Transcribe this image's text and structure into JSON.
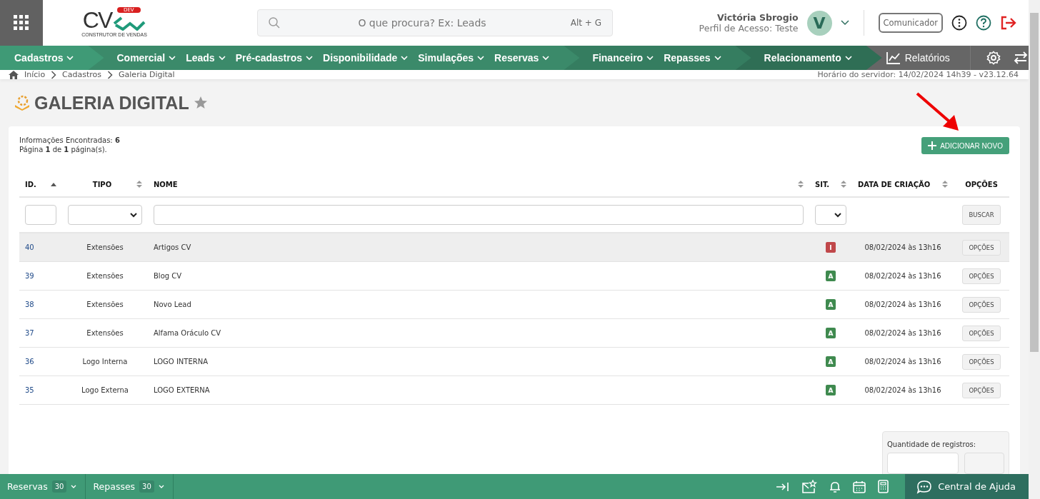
{
  "header": {
    "logo": {
      "mark": "CV",
      "badge": "DEV",
      "tagline": "CONSTRUTOR DE VENDAS"
    },
    "search": {
      "placeholder": "O que procura? Ex: Leads",
      "shortcut": "Alt + G"
    },
    "user": {
      "name": "Victória Sbrogio",
      "profile": "Perfil de Acesso: Teste",
      "initial": "V"
    },
    "communicator": "Comunicador"
  },
  "nav": {
    "groups": [
      {
        "items": [
          "Cadastros"
        ]
      },
      {
        "items": [
          "Comercial",
          "Leads",
          "Pré-cadastros",
          "Disponibilidade",
          "Simulações",
          "Reservas"
        ]
      },
      {
        "items": [
          "Financeiro",
          "Repasses"
        ]
      },
      {
        "items": [
          "Relacionamento"
        ]
      }
    ],
    "reports": "Relatórios"
  },
  "breadcrumb": [
    "Início",
    "Cadastros",
    "Galeria Digital"
  ],
  "server_time": "Horário do servidor: 14/02/2024 14h39 - v23.12.64",
  "page": {
    "title": "GALERIA DIGITAL",
    "favorite": false
  },
  "summary": {
    "found_label": "Informações Encontradas:",
    "found": "6",
    "page_text": "Página **1** de **1** página(s)."
  },
  "add_button": "ADICIONAR NOVO",
  "table": {
    "columns": [
      {
        "label": "ID.",
        "sortable": true,
        "sorted": true
      },
      {
        "label": "TIPO",
        "sortable": true,
        "sorted": false
      },
      {
        "label": "NOME",
        "sortable": true,
        "sorted": false
      },
      {
        "label": "SIT.",
        "sortable": true,
        "sorted": false
      },
      {
        "label": "DATA DE CRIAÇÃO",
        "sortable": true,
        "sorted": false
      },
      {
        "label": "OPÇÕES",
        "sortable": false
      }
    ],
    "filters": [
      {
        "kind": "input"
      },
      {
        "kind": "select"
      },
      {
        "kind": "input"
      },
      {
        "kind": "select"
      },
      {
        "kind": "blank"
      },
      {
        "kind": "button"
      }
    ],
    "search_button": "BUSCAR",
    "rows": [
      {
        "id": "40",
        "type": "Extensões",
        "name": "Artigos CV",
        "status": "I",
        "color": "#c0474a",
        "date": "08/02/2024 às 13h16",
        "options": "OPÇÕES",
        "highlighted": true
      },
      {
        "id": "39",
        "type": "Extensões",
        "name": "Blog CV",
        "status": "A",
        "color": "#3f8a4f",
        "date": "08/02/2024 às 13h16",
        "options": "OPÇÕES",
        "highlighted": false
      },
      {
        "id": "38",
        "type": "Extensões",
        "name": "Novo Lead",
        "status": "A",
        "color": "#3f8a4f",
        "date": "08/02/2024 às 13h16",
        "options": "OPÇÕES",
        "highlighted": false
      },
      {
        "id": "37",
        "type": "Extensões",
        "name": "Alfama Oráculo CV",
        "status": "A",
        "color": "#3f8a4f",
        "date": "08/02/2024 às 13h16",
        "options": "OPÇÕES",
        "highlighted": false
      },
      {
        "id": "36",
        "type": "Logo Interna",
        "name": "LOGO INTERNA",
        "status": "A",
        "color": "#3f8a4f",
        "date": "08/02/2024 às 13h16",
        "options": "OPÇÕES",
        "highlighted": false
      },
      {
        "id": "35",
        "type": "Logo Externa",
        "name": "LOGO EXTERNA",
        "status": "A",
        "color": "#3f8a4f",
        "date": "08/02/2024 às 13h16",
        "options": "OPÇÕES",
        "highlighted": false
      }
    ]
  },
  "records": {
    "label": "Quantidade de registros:"
  },
  "bottom_bar": {
    "items": [
      {
        "label": "Reservas",
        "count": "30"
      },
      {
        "label": "Repasses",
        "count": "30"
      }
    ],
    "help": "Central de Ajuda"
  }
}
